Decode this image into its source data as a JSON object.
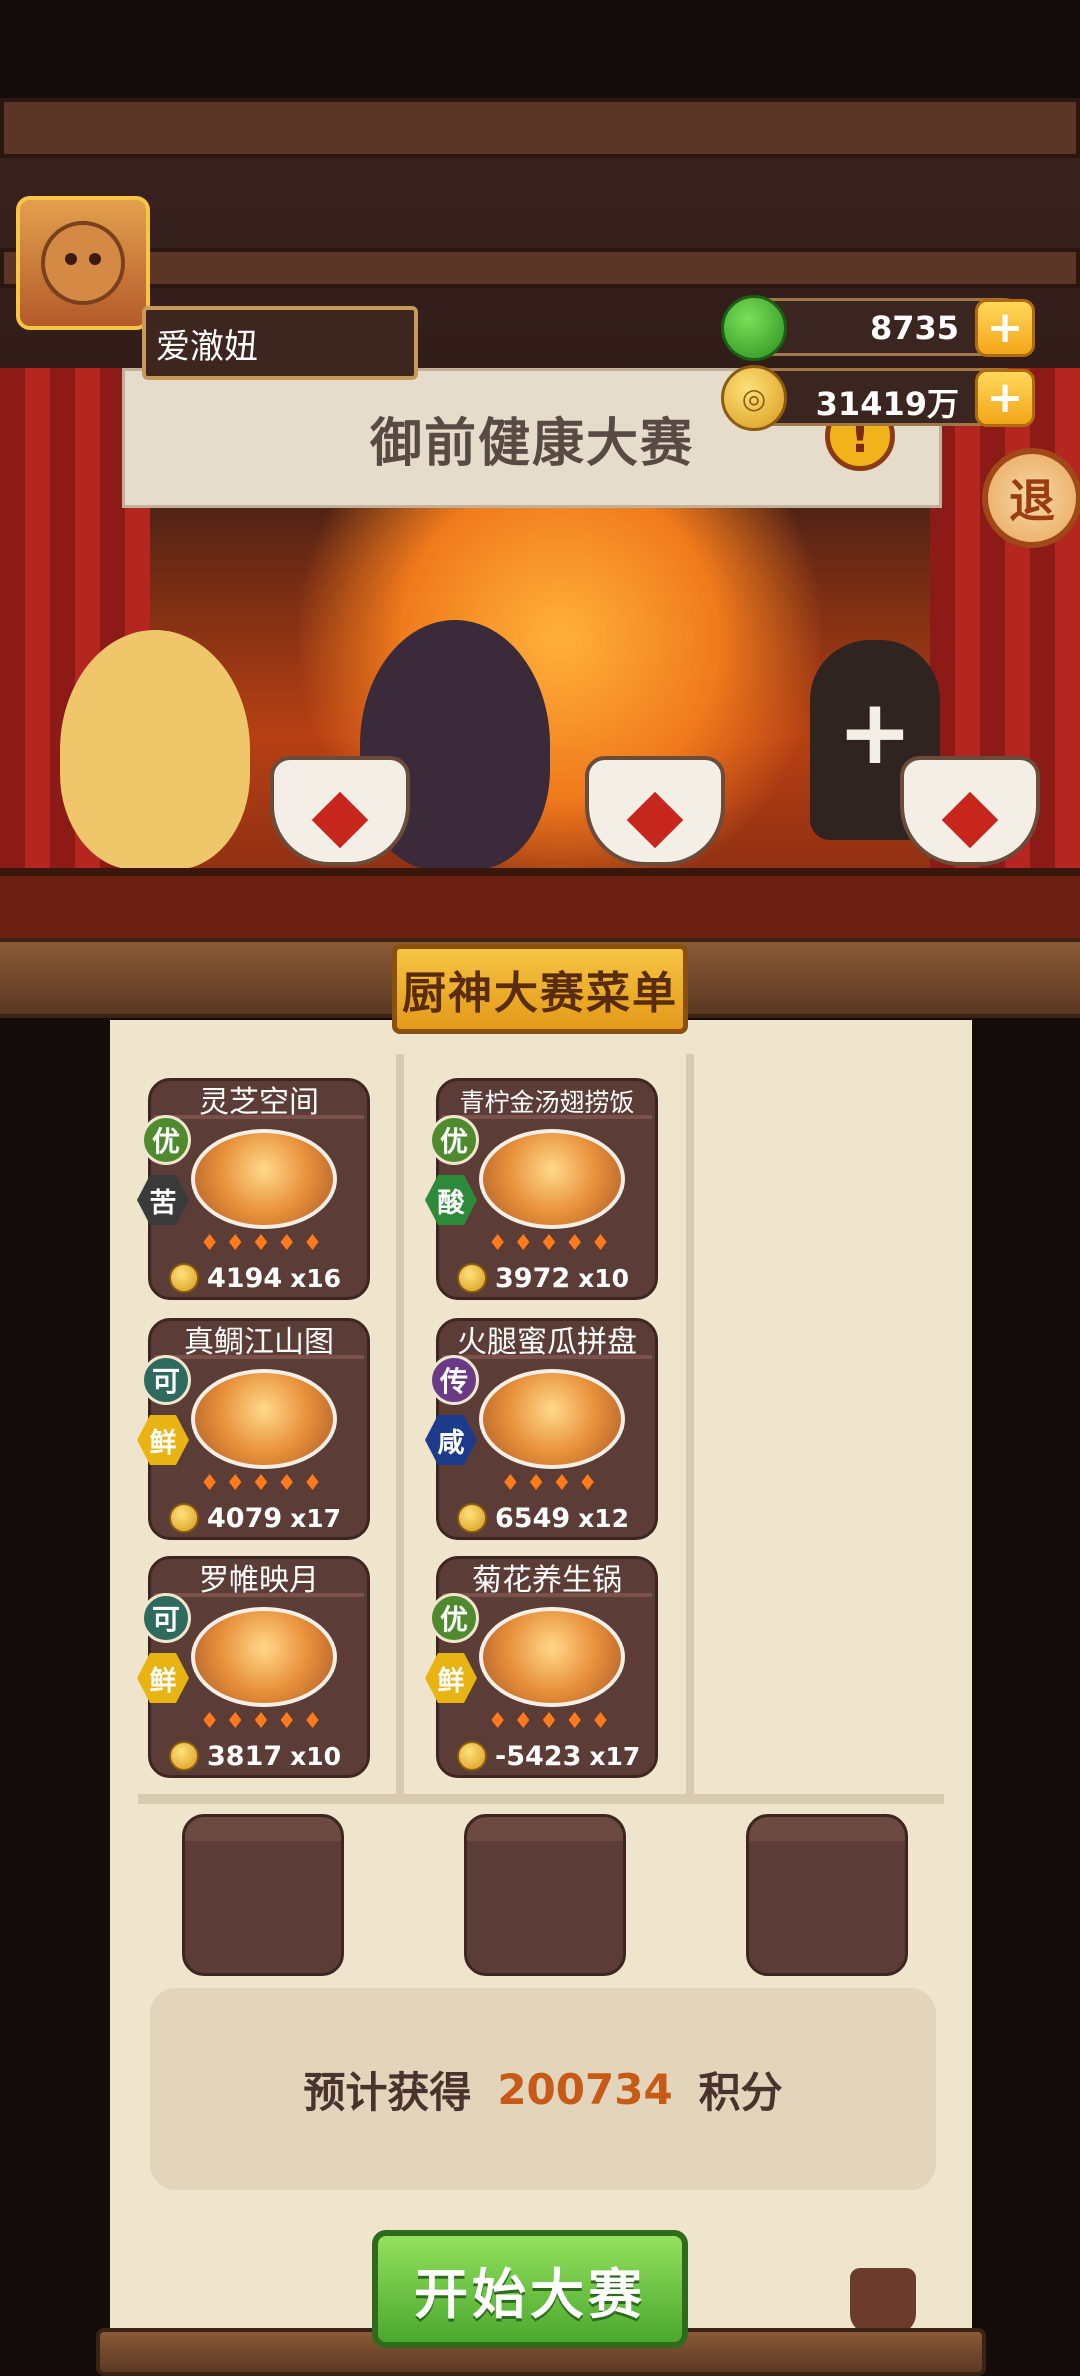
{
  "player": {
    "name": "爱澈妞"
  },
  "resources": {
    "jade": {
      "icon": "jade-icon",
      "value": "8735",
      "add_label": "+"
    },
    "coins": {
      "icon": "coin-icon",
      "glyph": "◎",
      "value": "31419万",
      "add_label": "+"
    }
  },
  "header": {
    "event_title": "御前健康大赛",
    "alert_glyph": "!",
    "exit_label": "退"
  },
  "stage": {
    "empty_slot_label": "+"
  },
  "menu": {
    "title": "厨神大赛菜单",
    "dishes": [
      {
        "name": "灵芝空间",
        "quality": "优",
        "flavor": "苦",
        "flames": "♦♦♦♦♦",
        "score": "4194",
        "count": "x16"
      },
      {
        "name": "青柠金汤翅捞饭",
        "quality": "优",
        "flavor": "酸",
        "flames": "♦♦♦♦♦",
        "score": "3972",
        "count": "x10"
      },
      {
        "name": "真鲷江山图",
        "quality": "可",
        "flavor": "鲜",
        "flames": "♦♦♦♦♦",
        "score": "4079",
        "count": "x17"
      },
      {
        "name": "火腿蜜瓜拼盘",
        "quality": "传",
        "flavor": "咸",
        "flames": "♦♦♦♦",
        "score": "6549",
        "count": "x12"
      },
      {
        "name": "罗帷映月",
        "quality": "可",
        "flavor": "鲜",
        "flames": "♦♦♦♦♦",
        "score": "3817",
        "count": "x10"
      },
      {
        "name": "菊花养生锅",
        "quality": "优",
        "flavor": "鲜",
        "flames": "♦♦♦♦♦",
        "score": "-5423",
        "count": "x17"
      }
    ]
  },
  "estimate": {
    "label": "预计获得",
    "value": "200734",
    "unit": "积分"
  },
  "start_button": {
    "label": "开始大赛"
  },
  "colors": {
    "quality_you": "#4f8a2e",
    "quality_ke": "#2f6a5e",
    "quality_chuan": "#6a3a86",
    "flavor_ku": "#3a3a3a",
    "flavor_suan": "#2e8a3a",
    "flavor_xian": "#e8b414",
    "flavor_xian2": "#1e3a8a",
    "accent": "#c65a16"
  }
}
